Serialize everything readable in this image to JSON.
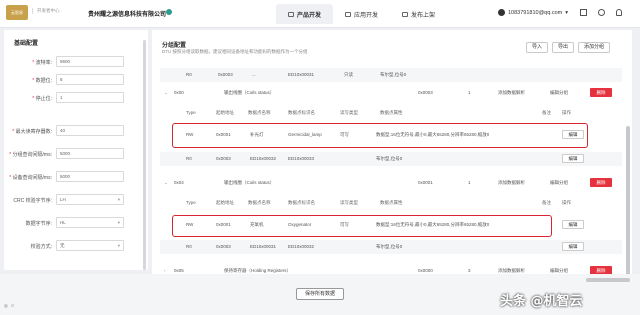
{
  "topbar": {
    "logo_text": "云智易",
    "brand_tag": "开发者中心",
    "company": "贵州耀之源信息科技有限公司",
    "nav": [
      "产品开发",
      "应用开发",
      "发布上架"
    ],
    "user": "1083791810@qq.com"
  },
  "left": {
    "title": "基础配置",
    "fields": [
      {
        "label": "波特率:",
        "required": true,
        "value": "9600"
      },
      {
        "label": "数据位:",
        "required": true,
        "value": "8"
      },
      {
        "label": "停止位:",
        "required": true,
        "value": "1"
      },
      {
        "label": "最大读寄存器数:",
        "required": true,
        "value": "40"
      },
      {
        "label": "分组查询间隔/ms:",
        "required": true,
        "value": "5000"
      },
      {
        "label": "设备查询间隔/ms:",
        "required": true,
        "value": "5000"
      },
      {
        "label": "CRC 校验字节序:",
        "required": false,
        "value": "LH"
      },
      {
        "label": "数据字节序:",
        "required": false,
        "value": "HL"
      },
      {
        "label": "校验方式:",
        "required": false,
        "value": "无"
      }
    ]
  },
  "right": {
    "title": "分组配置",
    "desc": "DTU 按照分组读取数据，建议相同设备地址和功能码的数据作为一个分组",
    "buttons": {
      "import": "导入",
      "export": "导出",
      "add_group": "添加分组"
    },
    "rows": [
      {
        "c1": "R0",
        "c2": "0x0003",
        "c3": "...",
        "c4": "ED10x00031",
        "c5": "只读",
        "c6": "布尔型,位号0"
      },
      {
        "c1": "0x00",
        "c2": "输出线圈（Coils status）",
        "c3": "0x0003",
        "c4": "1",
        "link": "添加数据解析",
        "edit": "编辑分组",
        "del": "删除"
      },
      {
        "c1": "Type",
        "c2": "起始地址",
        "c3": "数据点名称",
        "c4": "数据点标识名",
        "c5": "读写类型",
        "c6": "数据点属性",
        "c7": "备注",
        "c8": "操作"
      },
      {
        "c1": "RW",
        "c2": "0x0001",
        "c3": "补光灯",
        "c4": "Germicidal_lamp",
        "c5": "可写",
        "c6": "数据型:16位无符号,最小0,最大65280,分辨率65280,缩放0",
        "edit": "编辑"
      },
      {
        "c1": "R0",
        "c2": "0x0003",
        "c3": "ED10x00032",
        "c4": "ED10x00033",
        "c6": "布尔型,位号0",
        "edit": "编辑"
      },
      {
        "c1": "0x04",
        "c2": "输出线圈（Coils status）",
        "c3": "0x0001",
        "c4": "1",
        "link": "添加数据解析",
        "edit": "编辑分组",
        "del": "删除"
      },
      {
        "c1": "Type",
        "c2": "起始地址",
        "c3": "数据点名称",
        "c4": "数据点标识名",
        "c5": "读写类型",
        "c6": "数据点属性",
        "c7": "备注",
        "c8": "操作"
      },
      {
        "c1": "RW",
        "c2": "0x0001",
        "c3": "充氧机",
        "c4": "Oxygenator",
        "c5": "可写",
        "c6": "数据型:16位无符号,最小0,最大65280,分辨率65280,缩放0",
        "edit": "编辑"
      },
      {
        "c1": "R0",
        "c2": "0x0003",
        "c3": "ED10x00031",
        "c4": "ED10x00032",
        "c6": "布尔型,位号0",
        "edit": "编辑"
      },
      {
        "c1": "0x05",
        "c2": "保持寄存器（Holding Registers）",
        "c3": "0x0000",
        "c4": "3",
        "link": "添加数据解析",
        "edit": "编辑分组",
        "del": "删除"
      }
    ]
  },
  "save_button": "保存所有数据",
  "watermark": "头条 @机智云"
}
